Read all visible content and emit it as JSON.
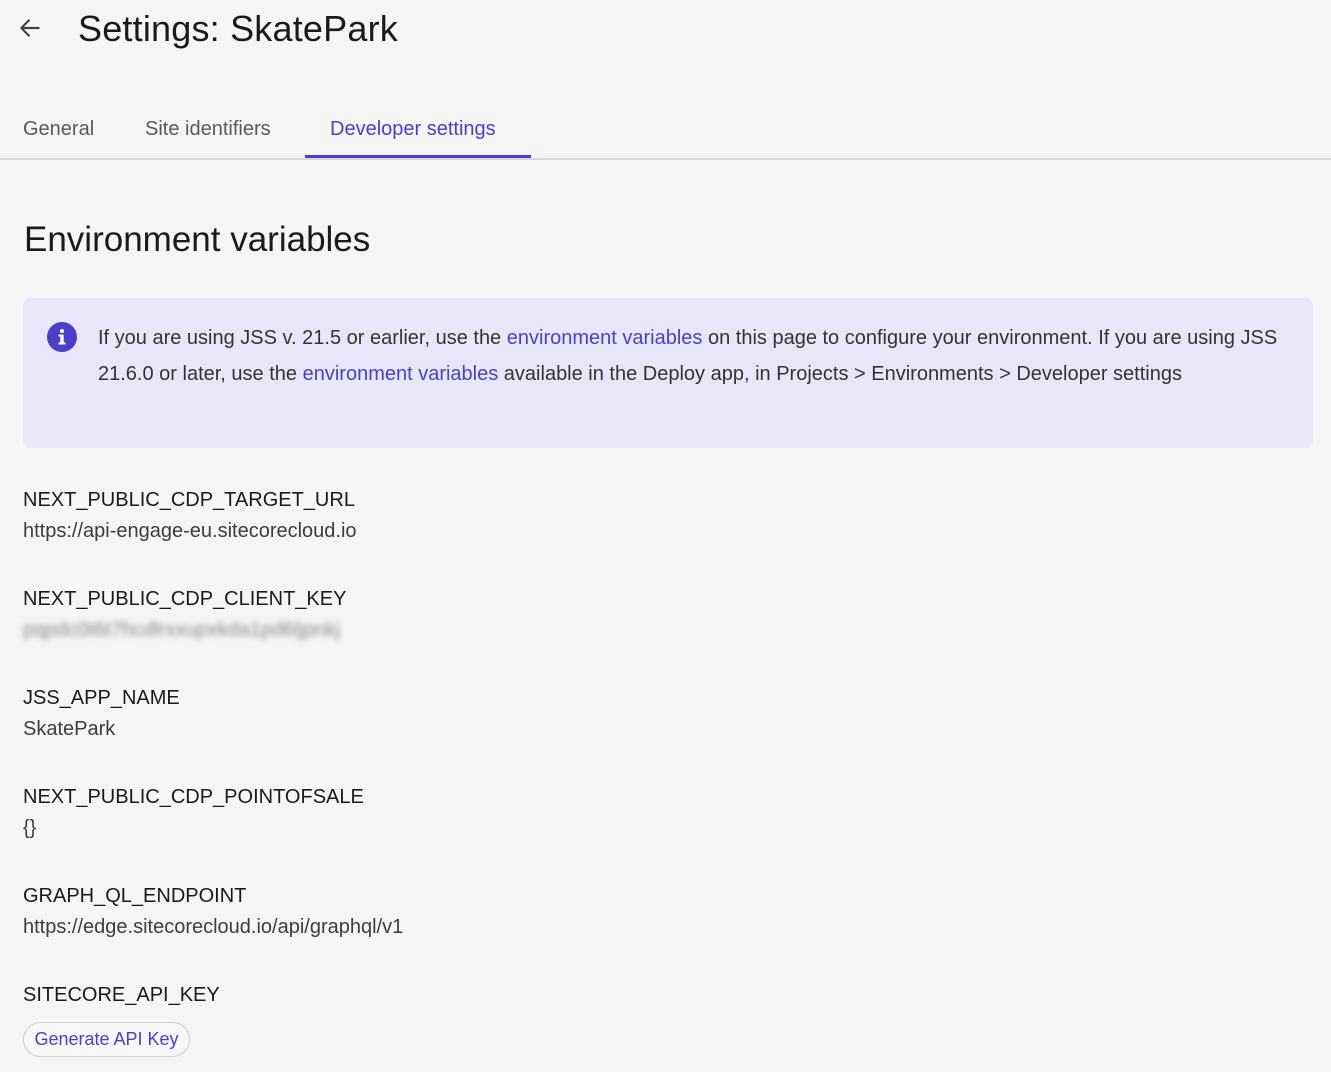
{
  "header": {
    "back_icon": "arrow-left-icon",
    "title": "Settings: SkatePark"
  },
  "tabs": [
    {
      "label": "General",
      "active": false
    },
    {
      "label": "Site identifiers",
      "active": false
    },
    {
      "label": "Developer settings",
      "active": true
    }
  ],
  "section": {
    "title": "Environment variables"
  },
  "info": {
    "icon": "info-icon",
    "text_1": "If you are using JSS v. 21.5 or earlier, use the ",
    "link_1": "environment variables",
    "text_2": " on this page to configure your environment. If you are using JSS 21.6.0 or later, use the ",
    "link_2": "environment variables",
    "text_3": " available in the Deploy app, in Projects > Environments > Developer settings"
  },
  "variables": [
    {
      "name": "NEXT_PUBLIC_CDP_TARGET_URL",
      "value": "https://api-engage-eu.sitecorecloud.io"
    },
    {
      "name": "NEXT_PUBLIC_CDP_CLIENT_KEY",
      "value": "pqpdc0t6t7hcdlrxxupxkda1pd6ljpnkj"
    },
    {
      "name": "JSS_APP_NAME",
      "value": "SkatePark"
    },
    {
      "name": "NEXT_PUBLIC_CDP_POINTOFSALE",
      "value": "{}"
    },
    {
      "name": "GRAPH_QL_ENDPOINT",
      "value": "https://edge.sitecorecloud.io/api/graphql/v1"
    },
    {
      "name": "SITECORE_API_KEY",
      "value": ""
    }
  ],
  "actions": {
    "generate_api_key": "Generate API Key"
  },
  "colors": {
    "accent": "#4b3fc8",
    "info_bg": "#e8e6f9",
    "page_bg": "#f5f5f5"
  }
}
